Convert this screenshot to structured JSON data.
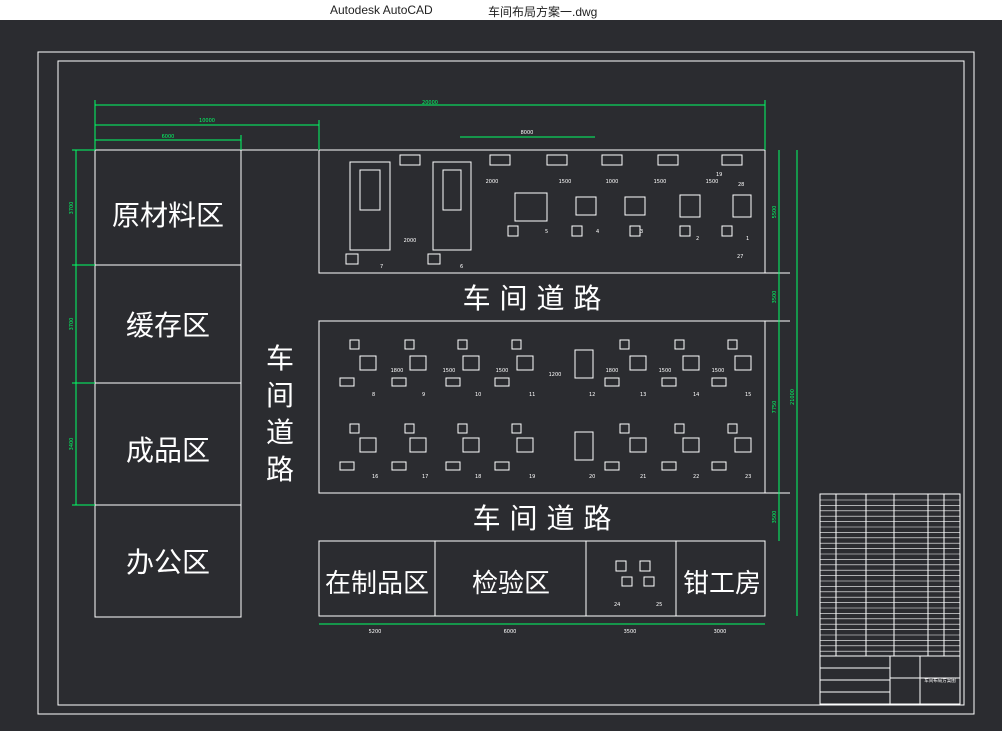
{
  "app": {
    "name": "Autodesk AutoCAD",
    "document": "车间布局方案一.dwg"
  },
  "colors": {
    "background": "#2b2c30",
    "lines": "#ffffff",
    "dimension": "#00ff66",
    "dimension_alt": "#00e0ff",
    "titlebar": "#ffffff"
  },
  "drawing": {
    "zones": {
      "raw_material": "原材料区",
      "buffer": "缓存区",
      "finished": "成品区",
      "office": "办公区",
      "wip": "在制品区",
      "inspection": "检验区",
      "fitter": "钳工房"
    },
    "roads": {
      "upper": "车 间 道 路",
      "lower": "车 间 道 路",
      "vertical": [
        "车",
        "间",
        "道",
        "路"
      ]
    },
    "dimensions": {
      "total_width": "20000",
      "left_width": "10000",
      "zone_width": "6000",
      "top_span": "8000",
      "machine_gap_1": "2000",
      "machine_gap_2": "2000",
      "machine_gap_3": "1500",
      "machine_gap_4": "1000",
      "machine_gap_5": "1500",
      "machine_gap_6": "1500",
      "bottom_wip": "5200",
      "bottom_inspection": "6000",
      "bottom_mid": "3500",
      "bottom_fitter": "3000",
      "right_top": "5500",
      "right_road": "3500",
      "right_middle": "7750",
      "right_total": "21000",
      "right_bottom": "3500",
      "left_1": "3700",
      "left_2": "3700",
      "left_3": "3400",
      "row_gap_a": "1800",
      "row_gap_b": "1500",
      "row_gap_c": "1500",
      "row_gap_d": "1200",
      "row_gap_e": "1800",
      "row_gap_f": "1500",
      "row_gap_g": "1500"
    },
    "machine_tags_top": [
      "7",
      "6",
      "5",
      "4",
      "3",
      "2",
      "1"
    ],
    "machine_tags_row1": [
      "8",
      "9",
      "10",
      "11",
      "12",
      "13",
      "14",
      "15"
    ],
    "machine_tags_row2": [
      "16",
      "17",
      "18",
      "19",
      "20",
      "21",
      "22",
      "23"
    ],
    "small_tags": [
      "19",
      "27",
      "28",
      "24",
      "25"
    ],
    "title_block": {
      "name_cell": "车间布局方案图"
    }
  }
}
